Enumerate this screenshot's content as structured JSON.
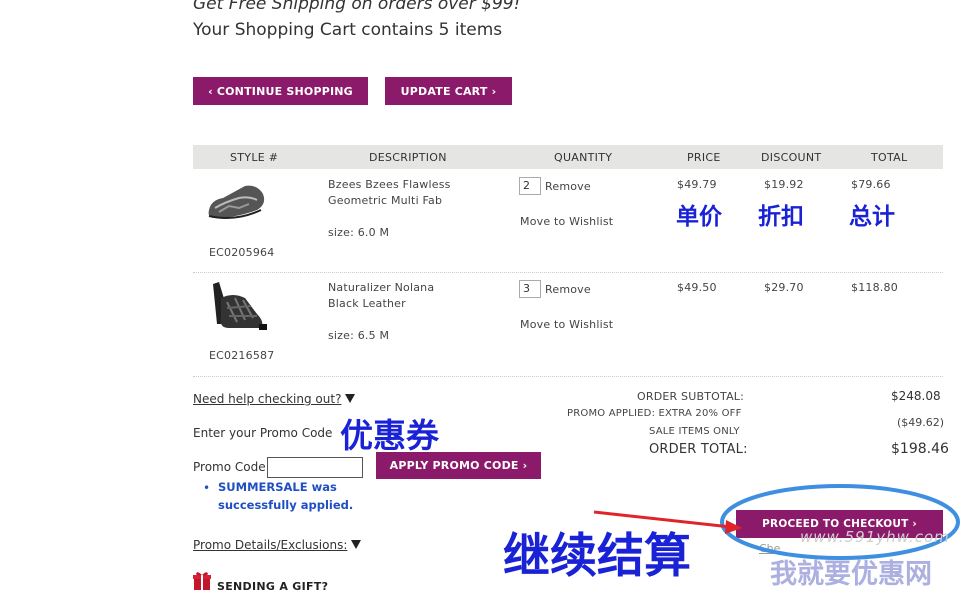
{
  "header": {
    "shipping_banner": "Get Free Shipping on orders over $99!",
    "cart_count_text": "Your Shopping Cart contains 5 items"
  },
  "buttons": {
    "continue_shopping": "‹ CONTINUE SHOPPING",
    "update_cart": "UPDATE CART ›",
    "apply_promo": "APPLY PROMO CODE ›",
    "proceed_checkout": "PROCEED TO CHECKOUT ›"
  },
  "table": {
    "headers": [
      "STYLE #",
      "DESCRIPTION",
      "QUANTITY",
      "PRICE",
      "DISCOUNT",
      "TOTAL"
    ],
    "rows": [
      {
        "style": "EC0205964",
        "desc_line1": "Bzees Bzees Flawless",
        "desc_line2": "Geometric Multi Fab",
        "size": "size: 6.0 M",
        "quantity": "2",
        "remove": "Remove",
        "wishlist": "Move to Wishlist",
        "price": "$49.79",
        "discount": "$19.92",
        "total": "$79.66"
      },
      {
        "style": "EC0216587",
        "desc_line1": "Naturalizer Nolana",
        "desc_line2": "Black Leather",
        "size": "size: 6.5 M",
        "quantity": "3",
        "remove": "Remove",
        "wishlist": "Move to Wishlist",
        "price": "$49.50",
        "discount": "$29.70",
        "total": "$118.80"
      }
    ]
  },
  "annotations": {
    "unit_price": "单价",
    "discount": "折扣",
    "total": "总计",
    "coupon": "优惠券",
    "checkout": "继续结算",
    "watermark_url": "www.591yhw.com",
    "watermark_text": "我就要优惠网"
  },
  "promo": {
    "help_link": "Need help checking out?",
    "enter_label": "Enter your Promo Code",
    "code_label": "Promo Code",
    "code_value": "",
    "success_line1": "SUMMERSALE was",
    "success_line2": "successfully applied.",
    "details_link": "Promo Details/Exclusions:",
    "gift_label": "SENDING A GIFT?"
  },
  "summary": {
    "subtotal_label": "ORDER SUBTOTAL:",
    "subtotal_value": "$248.08",
    "promo_label_1": "PROMO APPLIED: EXTRA 20% OFF",
    "promo_label_2": "SALE ITEMS ONLY",
    "promo_value": "($49.62)",
    "total_label": "ORDER TOTAL:",
    "total_value": "$198.46",
    "checkout_link_partial": "Che"
  },
  "colors": {
    "brand": "#8c1a6a",
    "annotation_blue": "#1a22d6",
    "annotation_red": "#e0242a",
    "success_blue": "#1f4fc2",
    "header_bg": "#e5e5e3"
  }
}
